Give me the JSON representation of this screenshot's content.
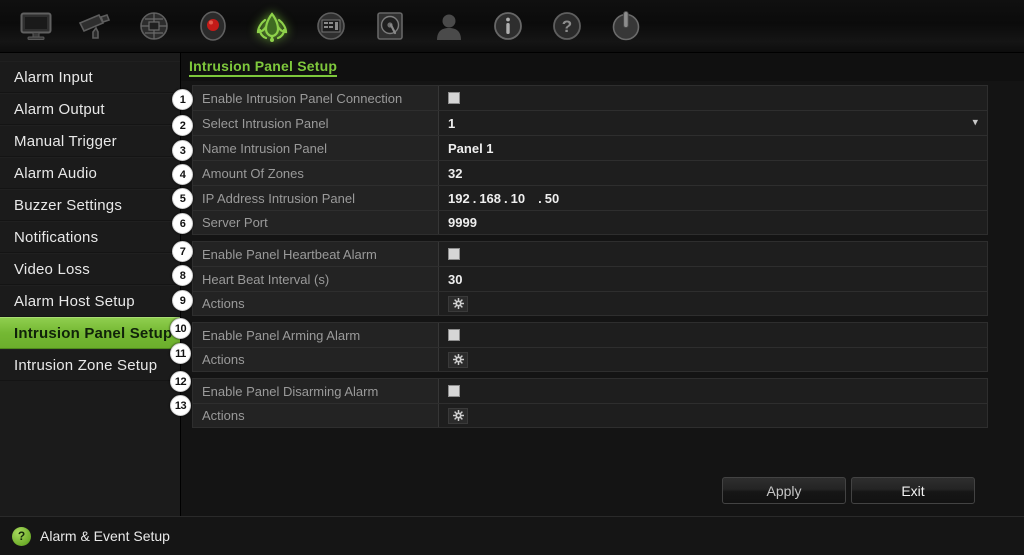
{
  "toolbar": {
    "items": [
      {
        "name": "monitor-icon",
        "label": "Display"
      },
      {
        "name": "camera-icon",
        "label": "Camera"
      },
      {
        "name": "network-icon",
        "label": "Network"
      },
      {
        "name": "record-icon",
        "label": "Record"
      },
      {
        "name": "alarm-icon",
        "label": "Alarm & Event",
        "selected": true
      },
      {
        "name": "device-icon",
        "label": "Device Management"
      },
      {
        "name": "hdd-icon",
        "label": "Storage"
      },
      {
        "name": "user-icon",
        "label": "User"
      },
      {
        "name": "info-icon",
        "label": "System Information"
      },
      {
        "name": "help-icon",
        "label": "Help"
      },
      {
        "name": "power-icon",
        "label": "Shutdown"
      }
    ]
  },
  "sidebar": {
    "items": [
      {
        "label": "Alarm Input",
        "active": false
      },
      {
        "label": "Alarm Output",
        "active": false
      },
      {
        "label": "Manual Trigger",
        "active": false
      },
      {
        "label": "Alarm Audio",
        "active": false
      },
      {
        "label": "Buzzer Settings",
        "active": false
      },
      {
        "label": "Notifications",
        "active": false
      },
      {
        "label": "Video Loss",
        "active": false
      },
      {
        "label": "Alarm Host Setup",
        "active": false
      },
      {
        "label": "Intrusion Panel Setup",
        "active": true
      },
      {
        "label": "Intrusion Zone Setup",
        "active": false
      }
    ]
  },
  "main": {
    "title": "Intrusion Panel Setup",
    "groups": [
      {
        "rows": [
          {
            "n": "1",
            "label": "Enable Intrusion Panel Connection",
            "type": "checkbox",
            "checked": false
          },
          {
            "n": "2",
            "label": "Select Intrusion Panel",
            "type": "dropdown",
            "value": "1",
            "options": [
              "1"
            ]
          },
          {
            "n": "3",
            "label": "Name Intrusion Panel",
            "type": "text",
            "value": "Panel 1"
          },
          {
            "n": "4",
            "label": "Amount Of Zones",
            "type": "text",
            "value": "32"
          },
          {
            "n": "5",
            "label": "IP Address Intrusion Panel",
            "type": "ip",
            "value": "192.168.10.50",
            "octets": [
              "192",
              "168",
              "10",
              "50"
            ]
          },
          {
            "n": "6",
            "label": "Server Port",
            "type": "text",
            "value": "9999"
          }
        ]
      },
      {
        "rows": [
          {
            "n": "7",
            "label": "Enable Panel Heartbeat Alarm",
            "type": "checkbox",
            "checked": false
          },
          {
            "n": "8",
            "label": "Heart Beat Interval (s)",
            "type": "text",
            "value": "30"
          },
          {
            "n": "9",
            "label": "Actions",
            "type": "gear"
          }
        ]
      },
      {
        "rows": [
          {
            "n": "10",
            "label": "Enable Panel Arming Alarm",
            "type": "checkbox",
            "checked": false
          },
          {
            "n": "11",
            "label": "Actions",
            "type": "gear"
          }
        ]
      },
      {
        "rows": [
          {
            "n": "12",
            "label": "Enable Panel Disarming Alarm",
            "type": "checkbox",
            "checked": false
          },
          {
            "n": "13",
            "label": "Actions",
            "type": "gear"
          }
        ]
      }
    ],
    "buttons": {
      "apply": "Apply",
      "exit": "Exit"
    }
  },
  "status": {
    "icon": "?",
    "text": "Alarm & Event Setup"
  },
  "colors": {
    "accent": "#7ec83c",
    "panel_bg": "#141414",
    "row_bg": "#232323",
    "text": "#e8e8e8"
  }
}
